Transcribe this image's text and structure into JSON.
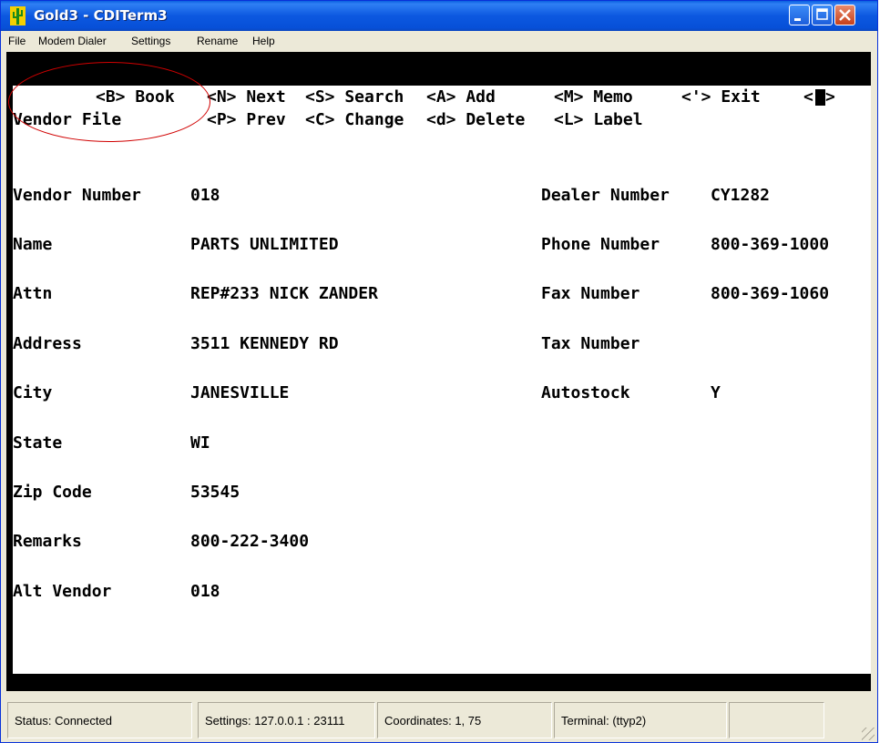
{
  "window": {
    "title": "Gold3 - CDITerm3",
    "colors": {
      "titlebar": "#0a5fe0",
      "close_button": "#c6401a",
      "annotation_circle": "#d00000"
    },
    "icons": {
      "app": "cactus-icon",
      "minimize": "minimize-icon",
      "maximize": "maximize-icon",
      "close": "close-icon"
    }
  },
  "menu": [
    "File",
    "Modem Dialer",
    "Settings",
    "Rename",
    "Help"
  ],
  "terminal": {
    "screen_title": "Vendor File",
    "commands_row1": [
      "<B> Book",
      "<N> Next",
      "<S> Search",
      "<A> Add",
      "<M> Memo",
      "<'> Exit",
      "<"
    ],
    "commands_row2": [
      "<P> Prev",
      "<C> Change",
      "<d> Delete",
      "<L> Label"
    ],
    "left_fields": [
      {
        "label": "Vendor Number",
        "value": "018"
      },
      {
        "label": "Name",
        "value": "PARTS UNLIMITED"
      },
      {
        "label": "Attn",
        "value": "REP#233 NICK ZANDER"
      },
      {
        "label": "Address",
        "value": "3511 KENNEDY RD"
      },
      {
        "label": "City",
        "value": "JANESVILLE"
      },
      {
        "label": "State",
        "value": "WI"
      },
      {
        "label": "Zip Code",
        "value": "53545"
      },
      {
        "label": "Remarks",
        "value": "800-222-3400"
      },
      {
        "label": "Alt Vendor",
        "value": "018"
      }
    ],
    "right_fields": [
      {
        "label": "Dealer Number",
        "value": "CY1282"
      },
      {
        "label": "Phone Number",
        "value": "800-369-1000"
      },
      {
        "label": "Fax Number",
        "value": "800-369-1060"
      },
      {
        "label": "Tax Number",
        "value": ""
      },
      {
        "label": "Autostock",
        "value": "Y"
      }
    ]
  },
  "status": {
    "status": "Status:  Connected",
    "settings": "Settings: 127.0.0.1 : 23111",
    "coordinates": "Coordinates:   1, 75",
    "terminal": "Terminal: (ttyp2)",
    "extra": ""
  }
}
